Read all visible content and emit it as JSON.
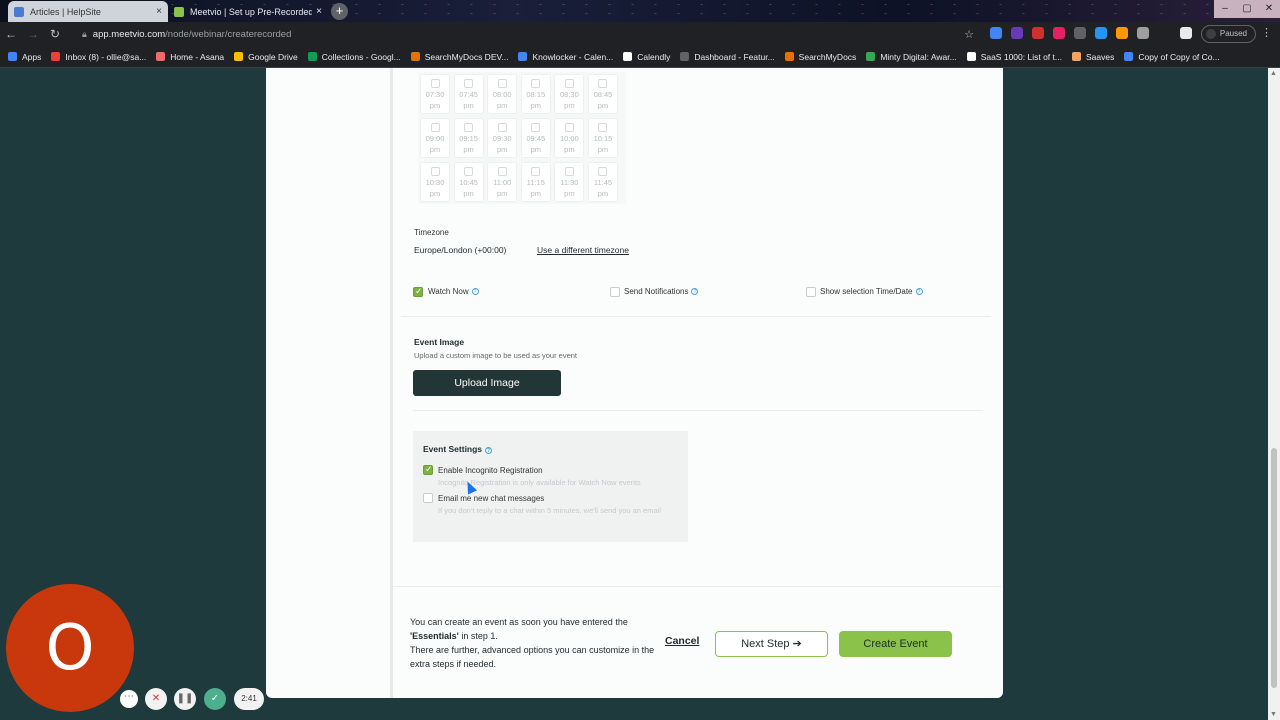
{
  "browser": {
    "tabs": [
      {
        "title": "Articles | HelpSite",
        "favicon_color": "#4a7bd1"
      },
      {
        "title": "Meetvio | Set up Pre-Recorded W",
        "favicon_color": "#8bc34a"
      }
    ],
    "url_host": "app.meetvio.com",
    "url_path": "/node/webinar/createrecorded",
    "profile_label": "Paused",
    "apps_label": "Apps",
    "bookmarks": [
      {
        "label": "Inbox (8) - ollie@sa...",
        "color": "#ea4335"
      },
      {
        "label": "Home - Asana",
        "color": "#f06a6a"
      },
      {
        "label": "Google Drive",
        "color": "#fbbc04"
      },
      {
        "label": "Collections - Googl...",
        "color": "#0f9d58"
      },
      {
        "label": "SearchMyDocs DEV...",
        "color": "#e37400"
      },
      {
        "label": "Knowlocker - Calen...",
        "color": "#4285f4"
      },
      {
        "label": "Calendly",
        "color": "#ffffff"
      },
      {
        "label": "Dashboard - Featur...",
        "color": "#5f6368"
      },
      {
        "label": "SearchMyDocs",
        "color": "#e37400"
      },
      {
        "label": "Minty Digital: Awar...",
        "color": "#34a853"
      },
      {
        "label": "SaaS 1000: List of t...",
        "color": "#ffffff"
      },
      {
        "label": "Saaves",
        "color": "#f4a261"
      },
      {
        "label": "Copy of Copy of Co...",
        "color": "#4285f4"
      }
    ]
  },
  "time_slots": [
    [
      "07:30",
      "pm"
    ],
    [
      "07:45",
      "pm"
    ],
    [
      "08:00",
      "pm"
    ],
    [
      "08:15",
      "pm"
    ],
    [
      "08:30",
      "pm"
    ],
    [
      "08:45",
      "pm"
    ],
    [
      "09:00",
      "pm"
    ],
    [
      "09:15",
      "pm"
    ],
    [
      "09:30",
      "pm"
    ],
    [
      "09:45",
      "pm"
    ],
    [
      "10:00",
      "pm"
    ],
    [
      "10:15",
      "pm"
    ],
    [
      "10:30",
      "pm"
    ],
    [
      "10:45",
      "pm"
    ],
    [
      "11:00",
      "pm"
    ],
    [
      "11:15",
      "pm"
    ],
    [
      "11:30",
      "pm"
    ],
    [
      "11:45",
      "pm"
    ]
  ],
  "timezone": {
    "label": "Timezone",
    "value": "Europe/London (+00:00)",
    "change_link": "Use a different timezone"
  },
  "options": {
    "watch_now": {
      "label": "Watch Now",
      "checked": true
    },
    "send_notifications": {
      "label": "Send Notifications",
      "checked": false
    },
    "show_selection": {
      "label": "Show selection Time/Date",
      "checked": false
    }
  },
  "event_image": {
    "title": "Event Image",
    "subtitle": "Upload a custom image to be used as your event",
    "button": "Upload Image"
  },
  "event_settings": {
    "title": "Event Settings",
    "incognito": {
      "label": "Enable Incognito Registration",
      "hint": "Incognito Registration is only available for Watch Now events",
      "checked": true
    },
    "email_chat": {
      "label": "Email me new chat messages",
      "hint": "If you don't reply to a chat within 5 minutes, we'll send you an email",
      "checked": false
    }
  },
  "footer": {
    "line1": "You can create an event as soon you have entered the",
    "essentials": "'Essentials'",
    "line1b": " in step 1.",
    "line2": "There are further, advanced options you can customize in the extra steps if needed.",
    "cancel": "Cancel",
    "next": "Next Step ➔",
    "create": "Create Event"
  },
  "recorder": {
    "avatar_letter": "O",
    "timer": "2:41"
  },
  "colors": {
    "background": "#1f3a3c",
    "accent_green": "#8bc34a",
    "dark_button": "#223636",
    "avatar": "#c9380c"
  }
}
